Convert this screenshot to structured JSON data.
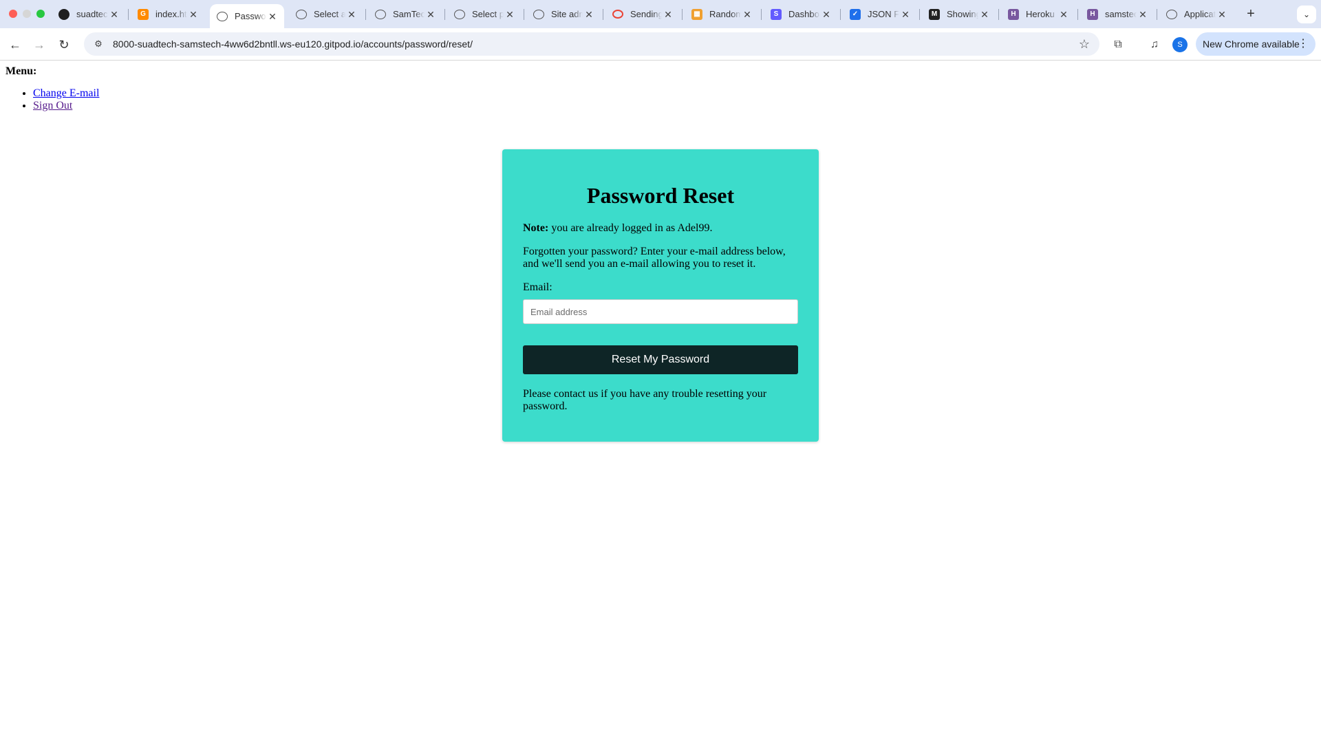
{
  "browser": {
    "tabs": [
      {
        "title": "suadtech",
        "icon": "github-icon",
        "color": "#1f1f1f",
        "glyph": ""
      },
      {
        "title": "index.html",
        "icon": "gitpod-icon",
        "color": "#ff8a00",
        "glyph": "G"
      },
      {
        "title": "Password Reset",
        "icon": "globe-icon",
        "color": "#555555",
        "glyph": "",
        "active": true
      },
      {
        "title": "Select a",
        "icon": "globe-icon",
        "color": "#555555",
        "glyph": ""
      },
      {
        "title": "SamTech",
        "icon": "globe-icon",
        "color": "#555555",
        "glyph": ""
      },
      {
        "title": "Select p",
        "icon": "globe-icon",
        "color": "#555555",
        "glyph": ""
      },
      {
        "title": "Site admin",
        "icon": "globe-icon",
        "color": "#555555",
        "glyph": ""
      },
      {
        "title": "Sending",
        "icon": "ring-icon",
        "color": "#ea4335",
        "glyph": "○"
      },
      {
        "title": "Random",
        "icon": "image-icon",
        "color": "#f0a030",
        "glyph": "▦"
      },
      {
        "title": "Dashboard",
        "icon": "stripe-icon",
        "color": "#635bff",
        "glyph": "S"
      },
      {
        "title": "JSON F",
        "icon": "check-icon",
        "color": "#1f6feb",
        "glyph": "✓"
      },
      {
        "title": "Showing",
        "icon": "mask-icon",
        "color": "#222222",
        "glyph": "M"
      },
      {
        "title": "Heroku",
        "icon": "heroku-icon",
        "color": "#79589f",
        "glyph": "H"
      },
      {
        "title": "samstech",
        "icon": "heroku-icon",
        "color": "#79589f",
        "glyph": "H"
      },
      {
        "title": "Application",
        "icon": "globe-icon",
        "color": "#555555",
        "glyph": ""
      }
    ],
    "url": "8000-suadtech-samstech-4ww6d2bntll.ws-eu120.gitpod.io/accounts/password/reset/",
    "profile_initial": "S",
    "update_label": "New Chrome available"
  },
  "menu": {
    "heading": "Menu:",
    "items": [
      "Change E-mail",
      "Sign Out"
    ]
  },
  "card": {
    "title": "Password Reset",
    "note_label": "Note:",
    "note_text": " you are already logged in as Adel99.",
    "forgot_text": "Forgotten your password? Enter your e-mail address below, and we'll send you an e-mail allowing you to reset it.",
    "email_label": "Email:",
    "email_placeholder": "Email address",
    "button_label": "Reset My Password",
    "contact_text": "Please contact us if you have any trouble resetting your password."
  },
  "colors": {
    "card_bg": "#3cdccb",
    "button_bg": "#0e2526",
    "link": "#0000ee",
    "link_visited": "#551a8b"
  }
}
